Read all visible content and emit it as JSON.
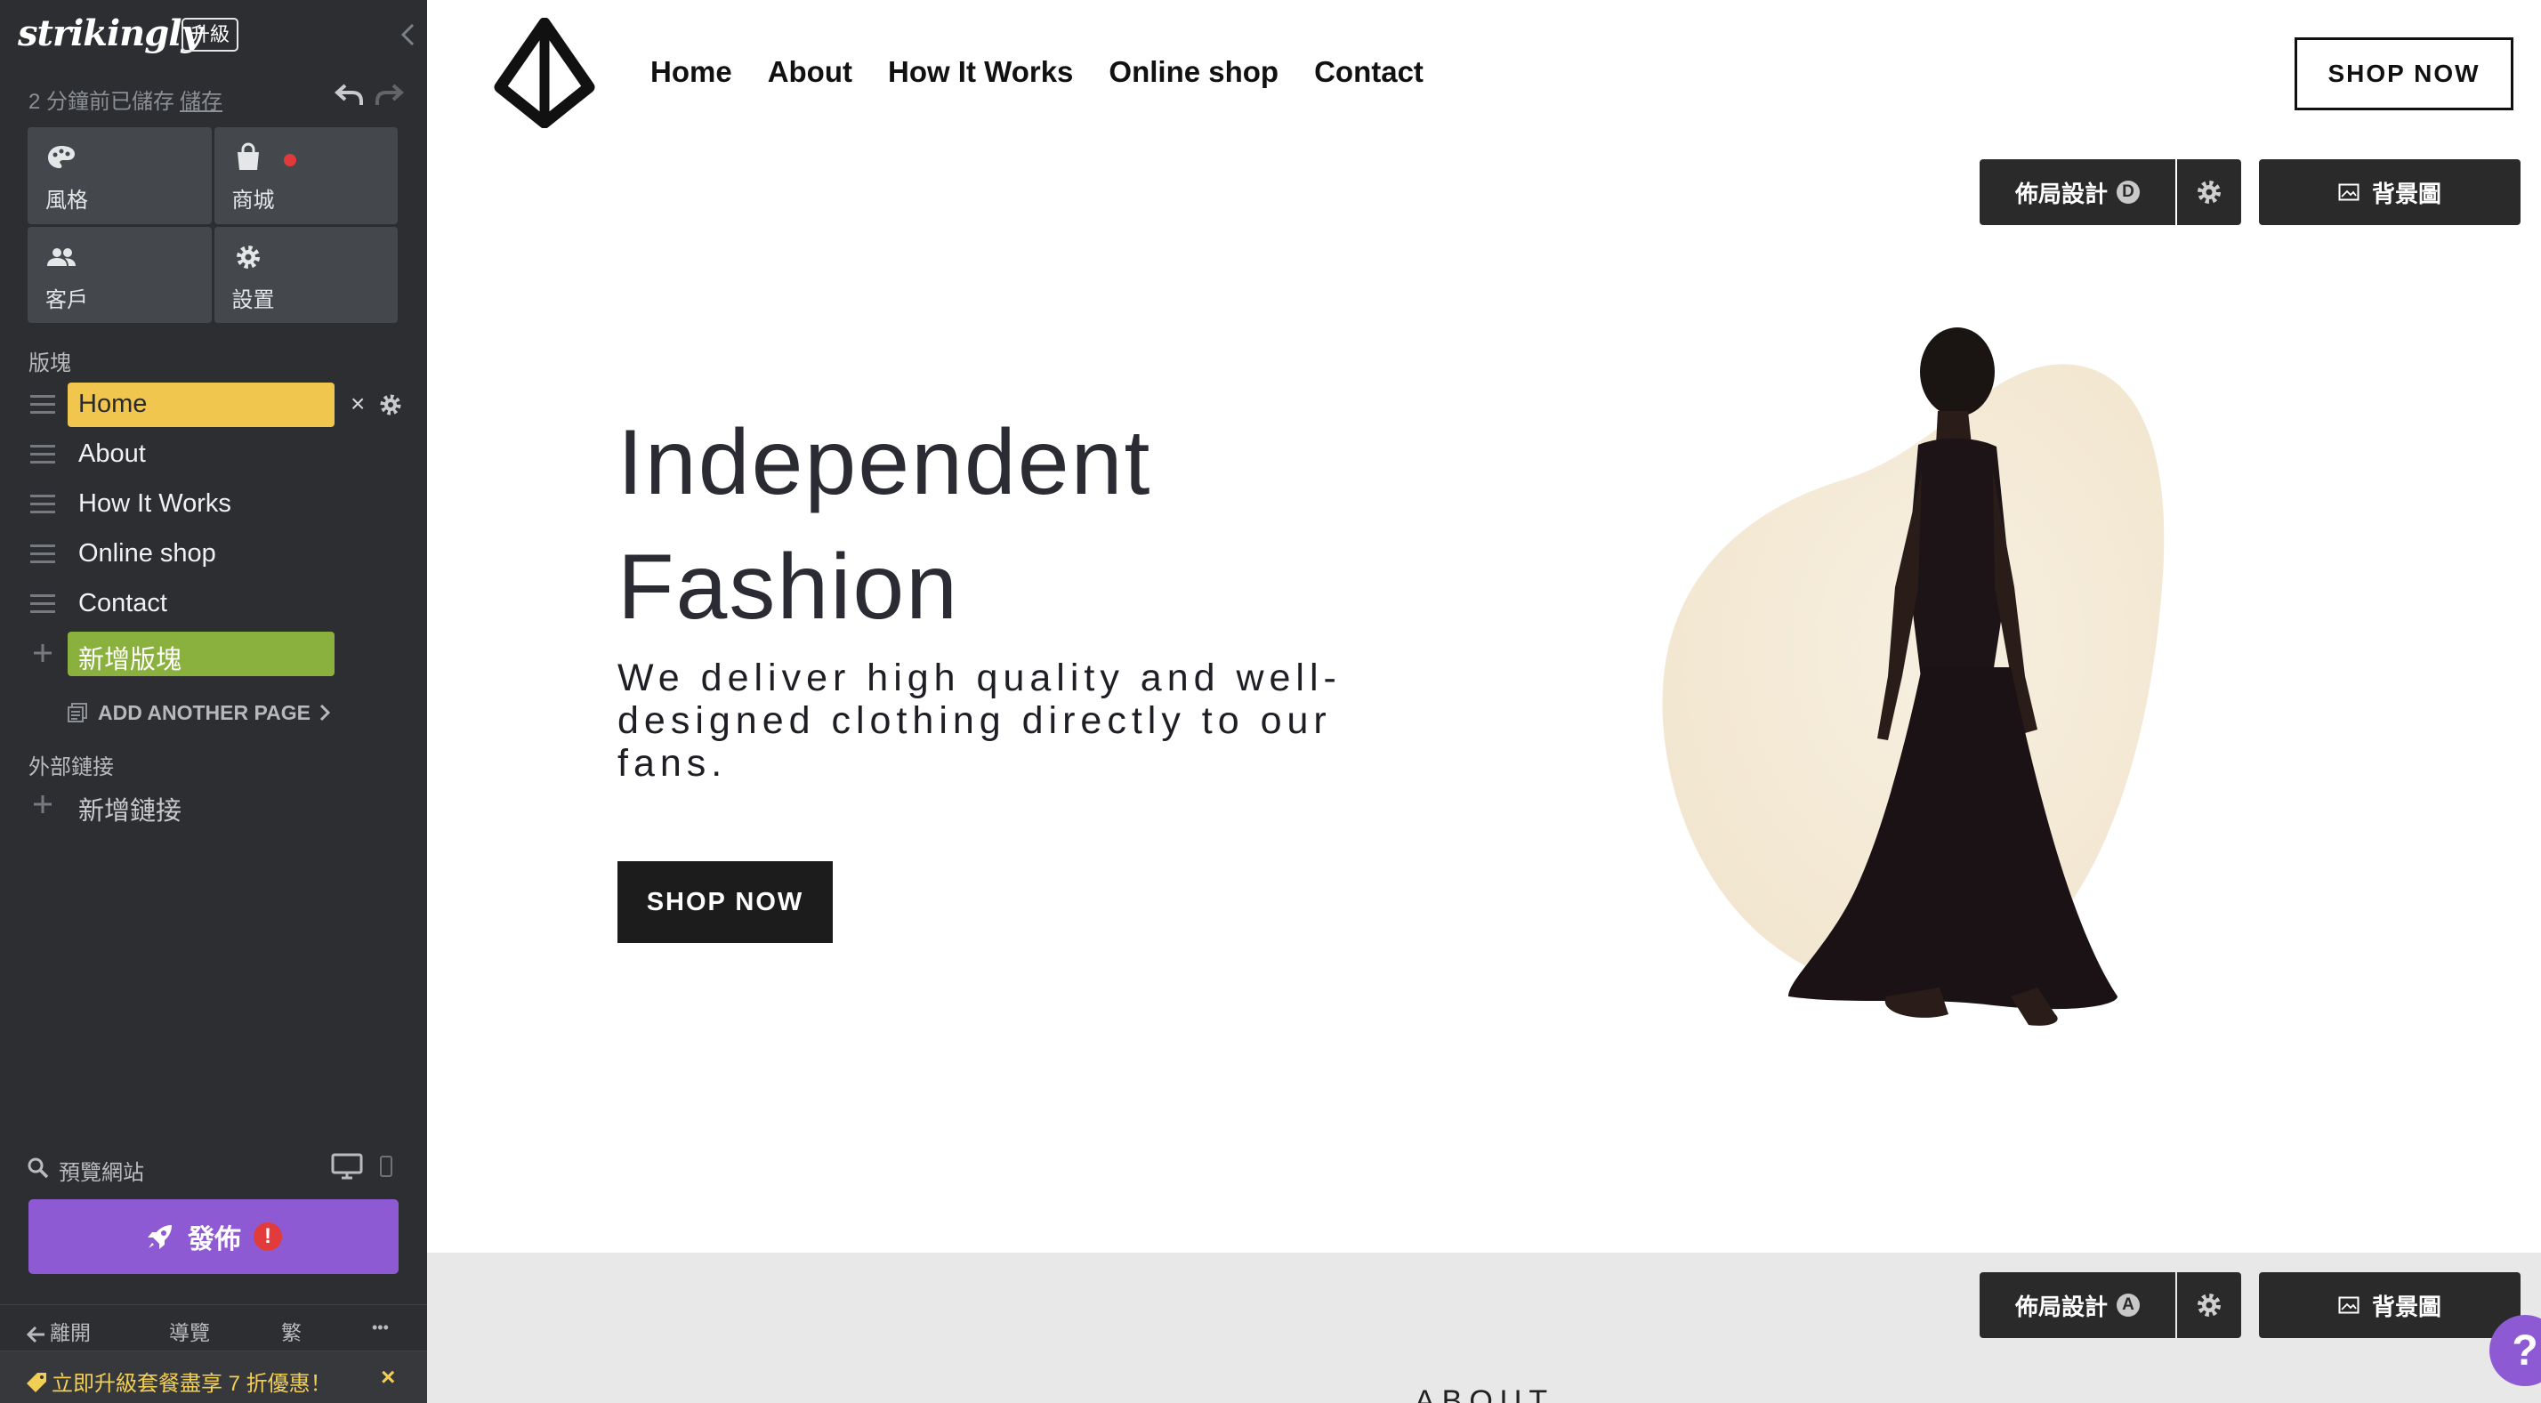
{
  "editor": {
    "logo": "strikingly",
    "upgrade_label": "升級",
    "save_status": "2 分鐘前已儲存",
    "save_link": "儲存",
    "tiles": [
      {
        "label": "風格",
        "icon": "palette-icon"
      },
      {
        "label": "商城",
        "icon": "shopping-bag-icon"
      },
      {
        "label": "客戶",
        "icon": "users-icon"
      },
      {
        "label": "設置",
        "icon": "gear-icon"
      }
    ],
    "sections_label": "版塊",
    "sections": [
      {
        "label": "Home",
        "active": true
      },
      {
        "label": "About"
      },
      {
        "label": "How It Works"
      },
      {
        "label": "Online shop"
      },
      {
        "label": "Contact"
      }
    ],
    "add_section_label": "新增版塊",
    "add_page_label": "ADD ANOTHER PAGE",
    "external_links_label": "外部鏈接",
    "add_link_label": "新增鏈接",
    "preview_label": "預覽網站",
    "publish_label": "發佈",
    "publish_alert": "!",
    "footer": {
      "leave": "離開",
      "guide": "導覽",
      "lang": "繁",
      "more": "•••"
    },
    "promo_text": "立即升級套餐盡享 7 折優惠！",
    "promo_close": "×",
    "colors": {
      "sidebar_bg": "#2c2e31",
      "active_section": "#f0c64e",
      "add_section": "#8ab13d",
      "publish": "#8e5ad4",
      "promo_text": "#f2cf54"
    }
  },
  "site": {
    "nav": [
      "Home",
      "About",
      "How It Works",
      "Online shop",
      "Contact"
    ],
    "header_button": "SHOP NOW",
    "toolbar_top": {
      "layout_label": "佈局設計",
      "layout_key": "D",
      "background_label": "背景圖"
    },
    "toolbar_bottom": {
      "layout_label": "佈局設計",
      "layout_key": "A",
      "background_label": "背景圖"
    },
    "hero": {
      "title_line1": "Independent",
      "title_line2": "Fashion",
      "subtitle": "We deliver high quality and well-designed clothing directly to our fans.",
      "button": "SHOP NOW"
    },
    "about_peek": "ABOUT",
    "help_label": "?"
  }
}
